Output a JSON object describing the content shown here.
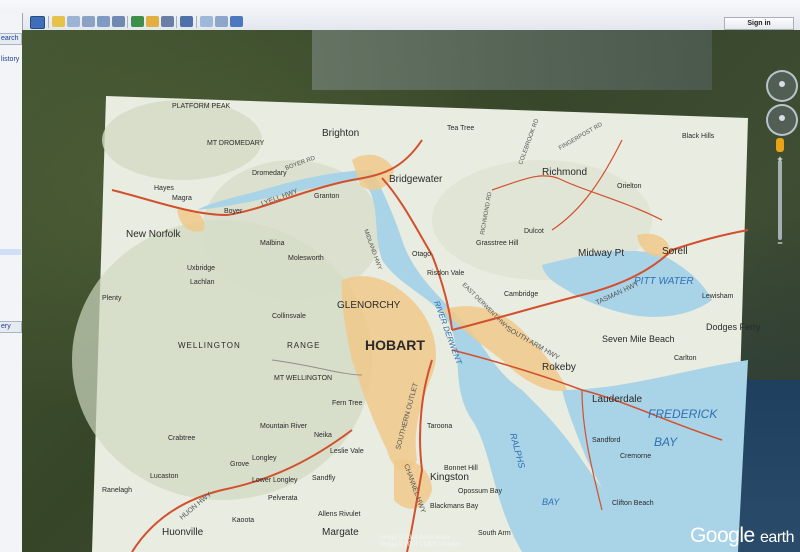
{
  "toolbar": {
    "buttons": [
      "sidebar-toggle",
      "placemark",
      "polygon",
      "path",
      "image-overlay",
      "record-tour",
      "historical-imagery",
      "sunlight",
      "planets",
      "ruler",
      "email",
      "print",
      "view-in-maps"
    ],
    "signin_label": "Sign in"
  },
  "sidebar": {
    "search_label": "earch",
    "history_label": "listory",
    "tour_label": "ery"
  },
  "map": {
    "places": [
      "PLATFORM PEAK",
      "Brighton",
      "Tea Tree",
      "Dromedary",
      "Granton",
      "Bridgewater",
      "Richmond",
      "Orielton",
      "Black Hills",
      "Hayes",
      "Magra",
      "Boyer",
      "New Norfolk",
      "Sorell",
      "Midway Pt",
      "Dulcot",
      "Molesworth",
      "Malbina",
      "Otago",
      "Risdon Vale",
      "Grasstree Hill",
      "Cambridge",
      "Lewisham",
      "GLENORCHY",
      "Collinsvale",
      "HOBART",
      "Seven Mile Beach",
      "Dodges Ferry",
      "Carlton",
      "Rokeby",
      "Lauderdale",
      "Fern Tree",
      "Mountain River",
      "Neika",
      "Taroona",
      "Cremorne",
      "Sandford",
      "Crabtree",
      "Lucaston",
      "Kingston",
      "Opossum Bay",
      "Clifton Beach",
      "Ranelagh",
      "Huonville",
      "Margate",
      "Blackmans Bay",
      "South Arm",
      "Lachlan",
      "Kaoota",
      "Allens Rivulet",
      "Sandfly",
      "Longley",
      "Lower Longley",
      "Grove",
      "Pelverata",
      "Leslie Vale",
      "Bonnet Hill",
      "WELLINGTON",
      "RANGE",
      "MT WELLINGTON",
      "MT DROMEDARY",
      "Uxbridge",
      "Plenty"
    ],
    "water": [
      "PITT WATER",
      "FREDERICK",
      "BAY",
      "RALPHS",
      "BAY",
      "RIVER DERWENT"
    ],
    "roads": [
      "LYELL HWY",
      "BOYER RD",
      "MIDLAND HWY",
      "TASMAN HWY",
      "HUON HWY",
      "SOUTHERN OUTLET",
      "SOUTH ARM HWY",
      "CHANNEL HWY",
      "FINGERPOST RD",
      "COLEBROOK RD",
      "RICHMOND RD",
      "EAST DERWENT HWY"
    ]
  },
  "copyright": [
    "Image © 2014 Aerometrex",
    "Image © 2014 CNES / Astrium"
  ],
  "logo": {
    "brand": "Google",
    "product": "earth"
  }
}
